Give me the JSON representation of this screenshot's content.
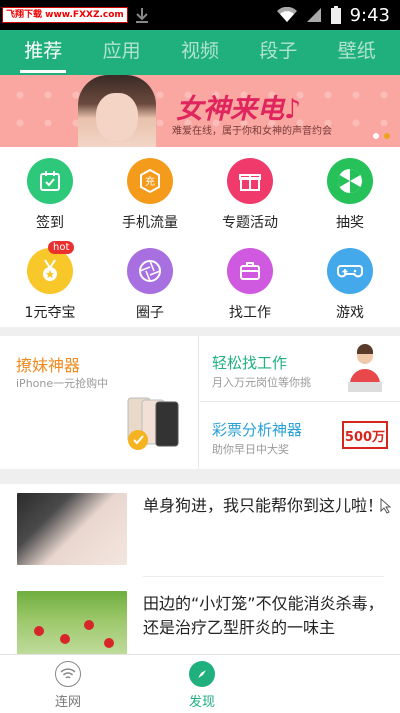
{
  "status_bar": {
    "watermark": "飞翔下载 www.FXXZ.com",
    "time": "9:43"
  },
  "tabs": [
    "推荐",
    "应用",
    "视频",
    "段子",
    "壁纸"
  ],
  "banner": {
    "title": "女神来电♪",
    "subtitle": "难爱在线，属于你和女神的声音约会"
  },
  "grid": [
    {
      "label": "签到",
      "icon": "calendar-check-icon",
      "color": "#2ec87a"
    },
    {
      "label": "手机流量",
      "icon": "charge-icon",
      "color": "#f49b1c"
    },
    {
      "label": "专题活动",
      "icon": "gift-icon",
      "color": "#ef3a6b"
    },
    {
      "label": "抽奖",
      "icon": "lottery-wheel-icon",
      "color": "#27c15a"
    },
    {
      "label": "1元夺宝",
      "icon": "medal-icon",
      "color": "#f8c72a"
    },
    {
      "label": "圈子",
      "icon": "aperture-icon",
      "color": "#a86fe0"
    },
    {
      "label": "找工作",
      "icon": "briefcase-icon",
      "color": "#cf5ae0"
    },
    {
      "label": "游戏",
      "icon": "gamepad-icon",
      "color": "#43a9ea"
    }
  ],
  "hot_badge": "hot",
  "promo": {
    "left_title": "撩妹神器",
    "left_sub": "iPhone一元抢购中",
    "right_top_title": "轻松找工作",
    "right_top_sub": "月入万元岗位等你挑",
    "right_bottom_title": "彩票分析神器",
    "right_bottom_sub": "助你早日中大奖",
    "badge": "500万"
  },
  "news": [
    {
      "text": "单身狗进，我只能帮你到这儿啦！"
    },
    {
      "text": "田边的“小灯笼”不仅能消炎杀毒，还是治疗乙型肝炎的一味主"
    }
  ],
  "bottom_nav": [
    {
      "label": "连网",
      "icon": "wifi-icon",
      "active": false
    },
    {
      "label": "发现",
      "icon": "compass-icon",
      "active": true
    }
  ],
  "colors": {
    "brand": "#1fb07e"
  }
}
